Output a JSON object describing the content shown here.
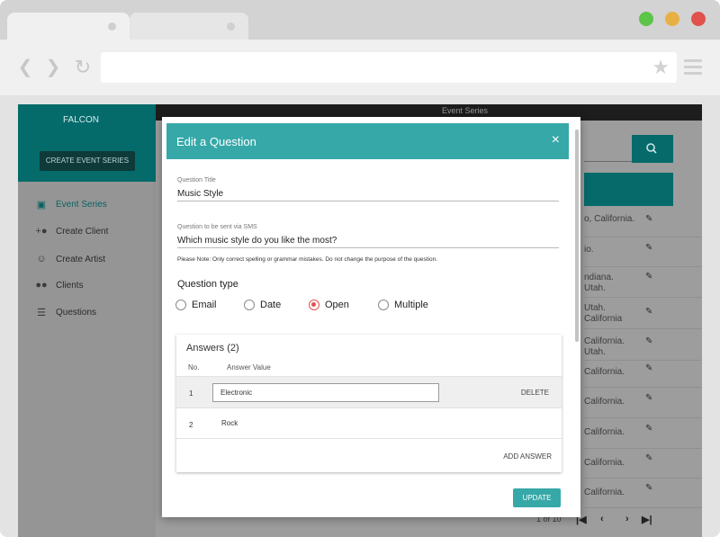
{
  "browser": {
    "traffic_colors": [
      "#5cc447",
      "#e8b043",
      "#e1524c"
    ],
    "icons": [
      "back-arrow-icon",
      "forward-arrow-icon",
      "reload-icon",
      "star-icon",
      "menu-icon"
    ]
  },
  "sidebar": {
    "brand": "FALCON",
    "create_button": "CREATE EVENT SERIES",
    "items": [
      {
        "label": "Event Series",
        "icon": "calendar-icon",
        "active": true
      },
      {
        "label": "Create Client",
        "icon": "add-person-icon",
        "active": false
      },
      {
        "label": "Create Artist",
        "icon": "face-icon",
        "active": false
      },
      {
        "label": "Clients",
        "icon": "people-icon",
        "active": false
      },
      {
        "label": "Questions",
        "icon": "list-icon",
        "active": false
      }
    ]
  },
  "main": {
    "topbar_title": "Event Series",
    "rows": [
      {
        "line1": "o, California.",
        "line2": ""
      },
      {
        "line1": "io.",
        "line2": ""
      },
      {
        "line1": "ndiana.",
        "line2": "Utah."
      },
      {
        "line1": "Utah.",
        "line2": "California"
      },
      {
        "line1": "California.",
        "line2": "Utah."
      },
      {
        "line1": "California.",
        "line2": ""
      },
      {
        "line1": "California.",
        "line2": ""
      },
      {
        "line1": "California.",
        "line2": ""
      },
      {
        "line1": "California.",
        "line2": ""
      },
      {
        "line1": "California.",
        "line2": ""
      }
    ],
    "pagination": {
      "text": "1 of 10",
      "first": "|◀",
      "prev": "‹",
      "next": "›",
      "last": "▶|"
    }
  },
  "modal": {
    "title": "Edit a Question",
    "close": "×",
    "question_title_label": "Question Title",
    "question_title_value": "Music Style",
    "sms_label": "Question to be sent via SMS",
    "sms_value": "Which music style do you like the most?",
    "note": "Please Note: Only correct spelling or grammar mistakes. Do not change the purpose of the question.",
    "question_type_label": "Question type",
    "question_types": [
      {
        "label": "Email",
        "selected": false
      },
      {
        "label": "Date",
        "selected": false
      },
      {
        "label": "Open",
        "selected": true
      },
      {
        "label": "Multiple",
        "selected": false
      }
    ],
    "answers": {
      "title": "Answers (2)",
      "col_no": "No.",
      "col_value": "Answer Value",
      "rows": [
        {
          "no": "1",
          "value": "Electronic",
          "action": "DELETE"
        },
        {
          "no": "2",
          "value": "Rock",
          "action": ""
        }
      ],
      "add_button": "ADD ANSWER"
    },
    "update_button": "UPDATE"
  }
}
